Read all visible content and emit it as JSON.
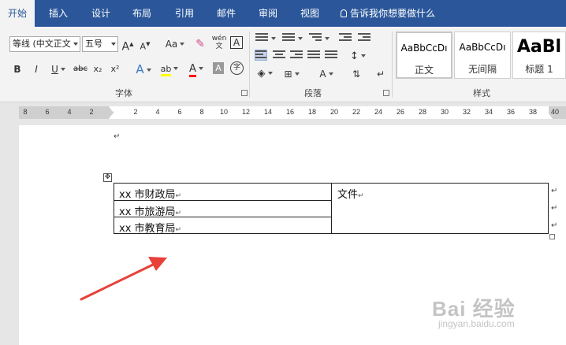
{
  "tabs": [
    {
      "label": "开始",
      "active": true
    },
    {
      "label": "插入"
    },
    {
      "label": "设计"
    },
    {
      "label": "布局"
    },
    {
      "label": "引用"
    },
    {
      "label": "邮件"
    },
    {
      "label": "审阅"
    },
    {
      "label": "视图"
    }
  ],
  "tellme": {
    "placeholder": "告诉我你想要做什么"
  },
  "font": {
    "family": "等线 (中文正文",
    "size": "五号",
    "grow_label": "A",
    "shrink_label": "A",
    "case_label": "Aa",
    "phonetic_label": "wén",
    "border_label": "A",
    "bold": "B",
    "italic": "I",
    "underline": "U",
    "strike": "abc",
    "subscript": "x₂",
    "superscript": "x²",
    "effects": "A",
    "highlight": "ab",
    "font_color": "A",
    "shade": "A",
    "enclose": "字",
    "group_label": "字体"
  },
  "paragraph": {
    "group_label": "段落",
    "sort_label": "A"
  },
  "styles": {
    "group_label": "样式",
    "items": [
      {
        "sample": "AaBbCcDı",
        "name": "正文"
      },
      {
        "sample": "AaBbCcDı",
        "name": "无间隔"
      },
      {
        "sample": "AaBl",
        "name": "标题 1"
      }
    ]
  },
  "ruler": {
    "ticks": [
      "8",
      "6",
      "4",
      "2",
      "2",
      "4",
      "6",
      "8",
      "10",
      "12",
      "14",
      "16",
      "18",
      "20",
      "22",
      "24",
      "26",
      "28",
      "30",
      "32",
      "34",
      "36",
      "38",
      "40"
    ]
  },
  "document": {
    "table": {
      "left_rows": [
        "xx 市财政局",
        "xx 市旅游局",
        "xx 市教育局"
      ],
      "right_cell": "文件"
    },
    "paragraph_mark": "↵",
    "move_handle": "✥"
  },
  "annotation": {
    "arrow_color": "#e8413a"
  },
  "watermark": {
    "text": "Bai 经验",
    "url": "jingyan.baidu.com"
  },
  "colors": {
    "ribbon_blue": "#2b579a",
    "highlight": "#ffff00",
    "font_red": "#ff0000"
  }
}
